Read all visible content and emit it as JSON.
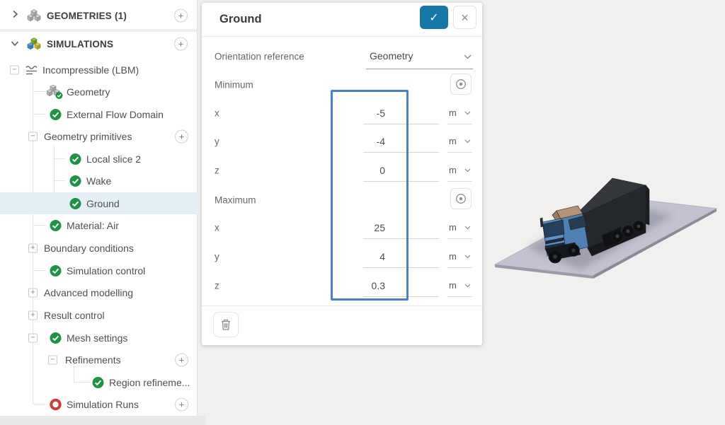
{
  "sidebar": {
    "sections": {
      "geometries": {
        "label": "GEOMETRIES (1)"
      },
      "simulations": {
        "label": "SIMULATIONS"
      }
    },
    "tree": [
      {
        "label": "Incompressible (LBM)"
      },
      {
        "label": "Geometry"
      },
      {
        "label": "External Flow Domain"
      },
      {
        "label": "Geometry primitives"
      },
      {
        "label": "Local slice 2"
      },
      {
        "label": "Wake"
      },
      {
        "label": "Ground",
        "selected": true
      },
      {
        "label": "Material: Air"
      },
      {
        "label": "Boundary conditions"
      },
      {
        "label": "Simulation control"
      },
      {
        "label": "Advanced modelling"
      },
      {
        "label": "Result control"
      },
      {
        "label": "Mesh settings"
      },
      {
        "label": "Refinements"
      },
      {
        "label": "Region refineme..."
      },
      {
        "label": "Simulation Runs"
      }
    ]
  },
  "panel": {
    "title": "Ground",
    "orientation": {
      "label": "Orientation reference",
      "value": "Geometry"
    },
    "minimum": {
      "label": "Minimum",
      "rows": [
        {
          "axis": "x",
          "value": "-5",
          "unit": "m"
        },
        {
          "axis": "y",
          "value": "-4",
          "unit": "m"
        },
        {
          "axis": "z",
          "value": "0",
          "unit": "m"
        }
      ]
    },
    "maximum": {
      "label": "Maximum",
      "rows": [
        {
          "axis": "x",
          "value": "25",
          "unit": "m"
        },
        {
          "axis": "y",
          "value": "4",
          "unit": "m"
        },
        {
          "axis": "z",
          "value": "0.3",
          "unit": "m"
        }
      ]
    }
  },
  "icons": {
    "add": "+",
    "collapse": "−",
    "expand": "+",
    "confirm": "✓",
    "close": "×"
  },
  "viewport": {
    "toolbar_icons": [
      "wireframe-cube-icon",
      "shaded-cube-icon",
      "highlighted-cube-icon"
    ]
  },
  "colors": {
    "accent_blue": "#1578a8",
    "annotation_blue": "#4a7fc1",
    "success_green": "#1f9245",
    "error_red": "#d23b3b",
    "selected_row": "#e4f0f6",
    "truck_cab_blue": "#4e80b4",
    "truck_trailer_gray": "#25282c",
    "ground_plane_gray": "#c3c2d0",
    "toolbar_cube_orange": "#d9773a"
  }
}
